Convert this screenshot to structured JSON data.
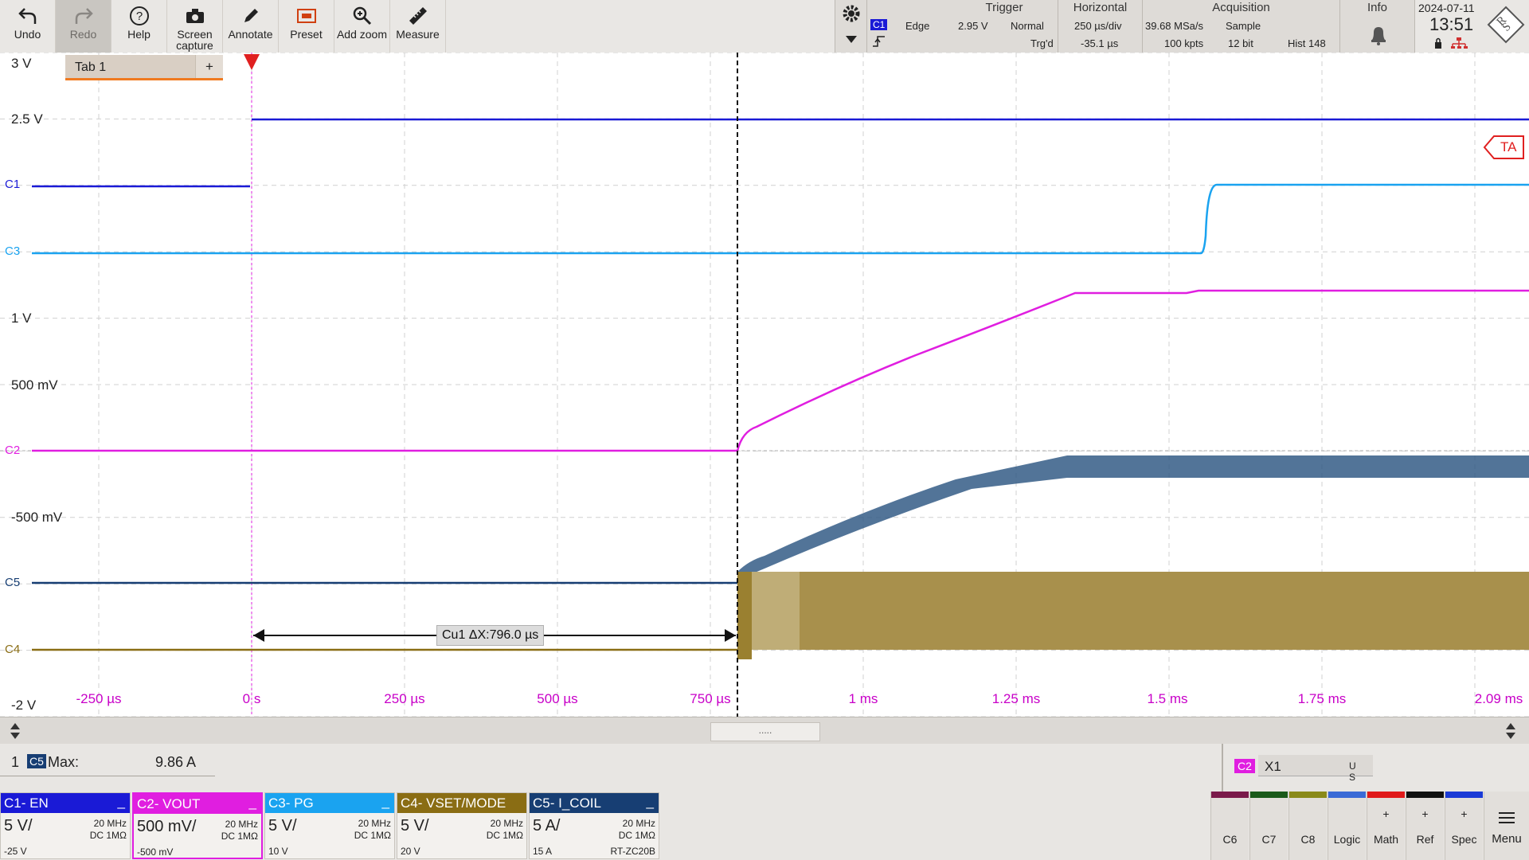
{
  "toolbar": {
    "buttons": [
      {
        "label": "Undo",
        "icon": "undo-icon"
      },
      {
        "label": "Redo",
        "icon": "redo-icon"
      },
      {
        "label": "Help",
        "icon": "help-icon"
      },
      {
        "label": "Screen capture",
        "icon": "camera-icon"
      },
      {
        "label": "Annotate",
        "icon": "pen-icon"
      },
      {
        "label": "Preset",
        "icon": "preset-icon"
      },
      {
        "label": "Add zoom",
        "icon": "zoom-icon"
      },
      {
        "label": "Measure",
        "icon": "ruler-icon"
      }
    ]
  },
  "trigger": {
    "header": "Trigger",
    "source": "C1",
    "type": "Edge",
    "level": "2.95 V",
    "mode": "Normal",
    "state": "Trg'd"
  },
  "horizontal": {
    "header": "Horizontal",
    "scale": "250 µs/div",
    "position": "-35.1 µs"
  },
  "acquisition": {
    "header": "Acquisition",
    "rate": "39.68 MSa/s",
    "mode": "Sample",
    "points": "100 kpts",
    "resolution": "12 bit",
    "hist": "Hist 148"
  },
  "info": {
    "header": "Info"
  },
  "clock": {
    "date": "2024-07-11",
    "time": "13:51"
  },
  "tab": {
    "label": "Tab 1",
    "add": "+"
  },
  "display": {
    "level_labels": [
      {
        "text": "3 V",
        "color": "#c800c8"
      },
      {
        "text": "2.5 V",
        "color": "#c800c8"
      },
      {
        "text": "1 V",
        "color": "#c800c8"
      },
      {
        "text": "500 mV",
        "color": "#c800c8"
      },
      {
        "text": "-500 mV",
        "color": "#c800c8"
      },
      {
        "text": "-2 V",
        "color": "#c800c8"
      }
    ],
    "x_ticks": [
      "-250 µs",
      "0 s",
      "250 µs",
      "500 µs",
      "750 µs",
      "1 ms",
      "1.25 ms",
      "1.5 ms",
      "1.75 ms",
      "2.09 ms"
    ],
    "channel_markers": [
      "C1",
      "C3",
      "C2",
      "C5",
      "C4"
    ],
    "cursor_readout": "Cu1 ΔX:796.0 µs",
    "ta_marker": "TA"
  },
  "scroll": {
    "thumb": "....."
  },
  "measurement": {
    "index": "1",
    "channel": "C5",
    "label": "Max:",
    "value": "9.86 A"
  },
  "xy": {
    "channel": "C2",
    "label": "X1",
    "units": "U S"
  },
  "channels": [
    {
      "title": "C1- EN",
      "scale": "5 V/",
      "bw": "20 MHz",
      "coupling": "DC 1MΩ",
      "offset": "-25 V",
      "color": "#1a1ad6"
    },
    {
      "title": "C2- VOUT",
      "scale": "500 mV/",
      "bw": "20 MHz",
      "coupling": "DC 1MΩ",
      "offset": "-500 mV",
      "color": "#e01ee0"
    },
    {
      "title": "C3- PG",
      "scale": "5 V/",
      "bw": "20 MHz",
      "coupling": "DC 1MΩ",
      "offset": "10 V",
      "color": "#1aa3f0"
    },
    {
      "title": "C4- VSET/MODE",
      "scale": "5 V/",
      "bw": "20 MHz",
      "coupling": "DC 1MΩ",
      "offset": "20 V",
      "color": "#8a6d14"
    },
    {
      "title": "C5- I_COIL",
      "scale": "5 A/",
      "bw": "20 MHz",
      "coupling": "DC 1MΩ",
      "offset": "15 A",
      "probe": "RT-ZC20B",
      "color": "#173e73"
    }
  ],
  "right_buttons": [
    {
      "label": "C6",
      "color": "#7a1a4a"
    },
    {
      "label": "C7",
      "color": "#1a5a1a"
    },
    {
      "label": "C8",
      "color": "#8a8a1a"
    },
    {
      "label": "Logic",
      "color": "#3a6ad6"
    },
    {
      "label": "Math",
      "plus": "+",
      "color": "#e01a1a"
    },
    {
      "label": "Ref",
      "plus": "+",
      "color": "#111111"
    },
    {
      "label": "Spec",
      "plus": "+",
      "color": "#1a3ad6"
    },
    {
      "label": "Menu",
      "color": "#e2dfdb"
    }
  ]
}
